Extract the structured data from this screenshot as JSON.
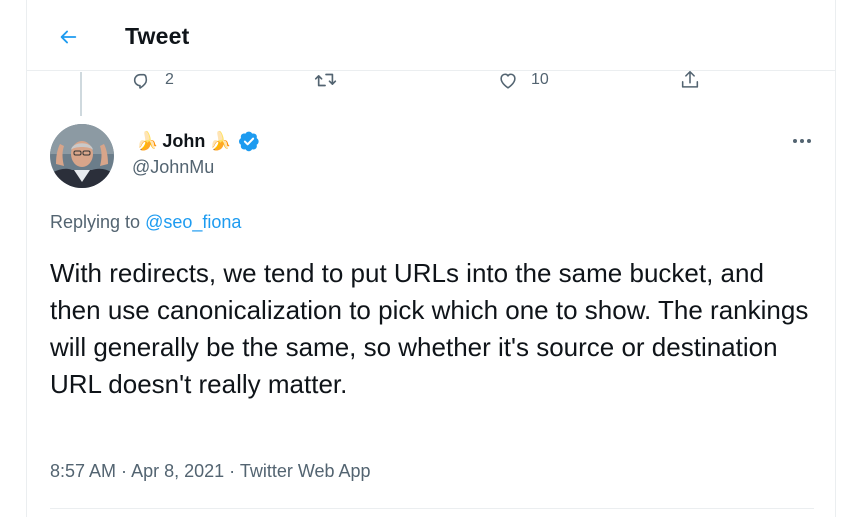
{
  "header": {
    "title": "Tweet",
    "back_icon": "arrow-left-icon"
  },
  "previous_tweet_actions": {
    "reply_count": "2",
    "retweet_count": "",
    "like_count": "10",
    "icons": [
      "reply-icon",
      "retweet-icon",
      "like-icon",
      "share-icon"
    ]
  },
  "tweet": {
    "author_name": "John",
    "author_emoji_left": "🍌",
    "author_emoji_right": "🍌",
    "handle": "@JohnMu",
    "replying_prefix": "Replying to ",
    "replying_to": "@seo_fiona",
    "text": "With redirects, we tend to put URLs into the same bucket, and then use canonicalization to pick which one to show. The rankings will generally be the same, so whether it's source or destination URL doesn't really matter.",
    "time": "8:57 AM",
    "separator": " · ",
    "date": "Apr 8, 2021",
    "source": "Twitter Web App"
  },
  "colors": {
    "accent": "#1d9bf0",
    "text_primary": "#0f1419",
    "text_secondary": "#536471",
    "border": "#ebeef0"
  }
}
